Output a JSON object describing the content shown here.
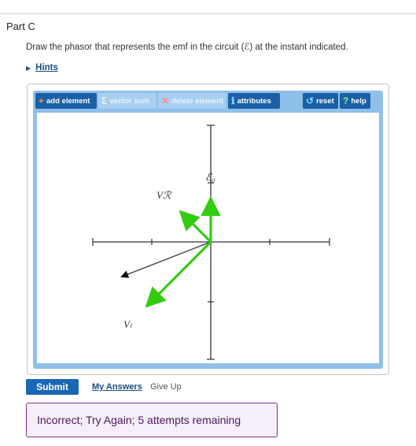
{
  "part": {
    "title": "Part C"
  },
  "question": {
    "text": "Draw the phasor that represents the emf in the circuit (ℰ) at the instant indicated."
  },
  "hints": {
    "label": "Hints"
  },
  "toolbar": {
    "add_element": "add element",
    "vector_sum": "vector sum",
    "delete_element": "delete element",
    "attributes": "attributes",
    "reset": "reset",
    "help": "help"
  },
  "diagram": {
    "labels": {
      "emf": "ℰ₀",
      "vr": "Vℛ",
      "vl": "Vₗ"
    },
    "colors": {
      "axis": "#333333",
      "green_phasor": "#33cc11",
      "user_phasor": "#555555",
      "user_head": "#111111"
    }
  },
  "actions": {
    "submit": "Submit",
    "my_answers": "My Answers",
    "give_up": "Give Up"
  },
  "feedback": {
    "text": "Incorrect; Try Again; 5 attempts remaining"
  }
}
